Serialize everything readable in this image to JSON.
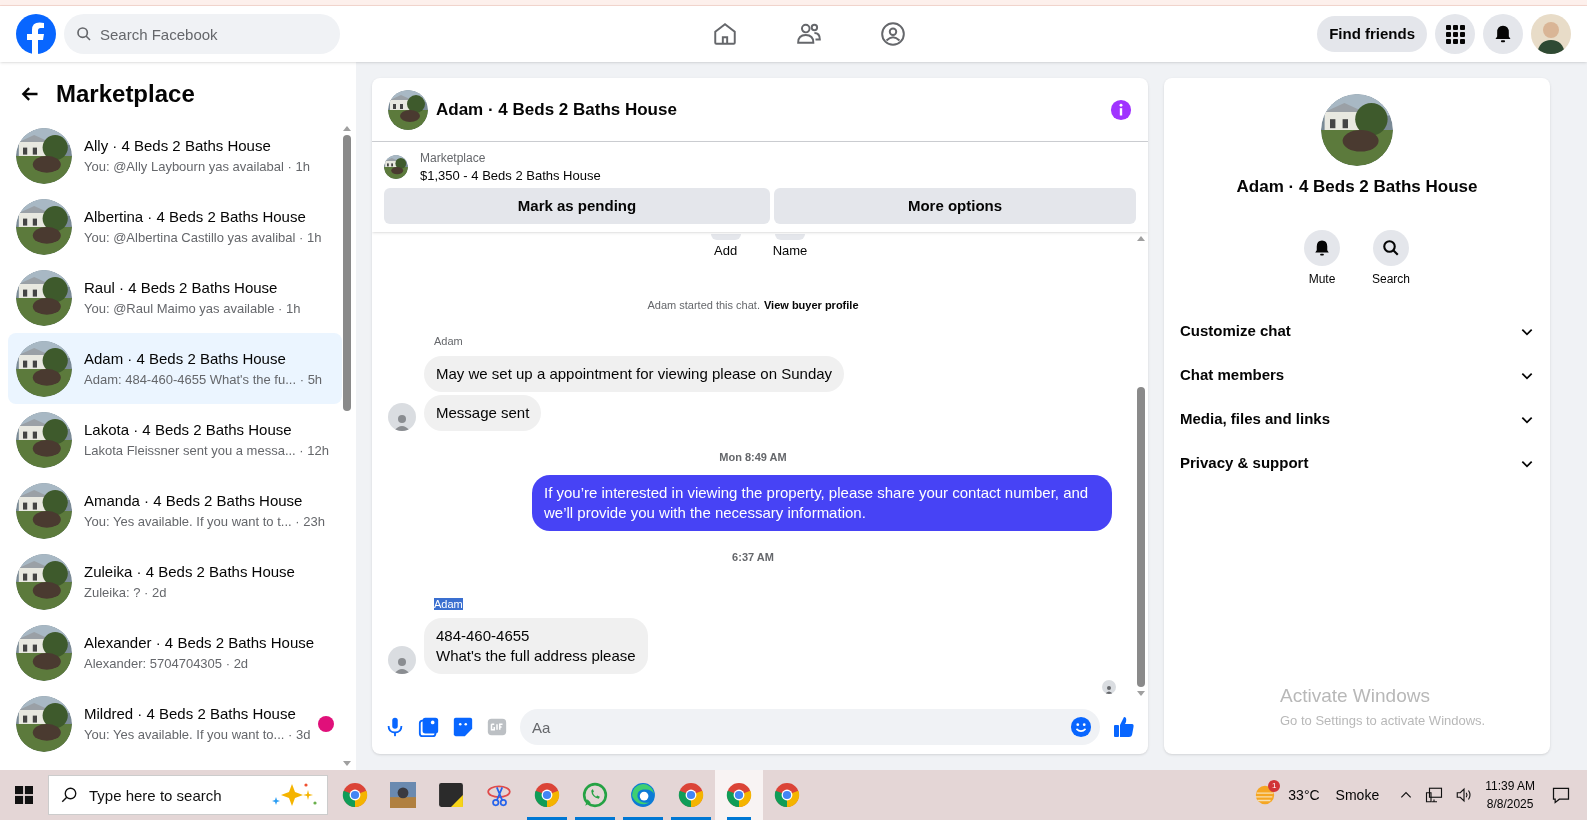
{
  "header": {
    "search": {
      "placeholder": "Search Facebook"
    },
    "find_friends": "Find friends"
  },
  "sidebar": {
    "title": "Marketplace",
    "items": [
      {
        "title": "Ally · 4 Beds 2 Baths House",
        "preview": "You: @Ally Laybourn yas availabal",
        "time": "· 1h",
        "selected": false,
        "unread": false
      },
      {
        "title": "Albertina · 4 Beds 2 Baths House",
        "preview": "You: @Albertina Castillo yas avalibal",
        "time": "· 1h",
        "selected": false,
        "unread": false
      },
      {
        "title": "Raul · 4 Beds 2 Baths House",
        "preview": "You: @Raul Maimo yas available",
        "time": "· 1h",
        "selected": false,
        "unread": false
      },
      {
        "title": "Adam · 4 Beds 2 Baths House",
        "preview": "Adam: 484-460-4655 What's the fu...",
        "time": "· 5h",
        "selected": true,
        "unread": false
      },
      {
        "title": "Lakota · 4 Beds 2 Baths House",
        "preview": "Lakota Fleissner sent you a messa...",
        "time": "· 12h",
        "selected": false,
        "unread": false
      },
      {
        "title": "Amanda · 4 Beds 2 Baths House",
        "preview": "You: Yes available. If you want to t...",
        "time": "· 23h",
        "selected": false,
        "unread": false
      },
      {
        "title": "Zuleika · 4 Beds 2 Baths House",
        "preview": "Zuleika: ?",
        "time": "· 2d",
        "selected": false,
        "unread": false
      },
      {
        "title": "Alexander · 4 Beds 2 Baths House",
        "preview": "Alexander: 5704704305",
        "time": "· 2d",
        "selected": false,
        "unread": false
      },
      {
        "title": "Mildred · 4 Beds 2 Baths House",
        "preview": "You: Yes available. If you want to...",
        "time": "· 3d",
        "selected": false,
        "unread": true
      }
    ]
  },
  "chat": {
    "title": "Adam · 4 Beds 2 Baths House",
    "listing": {
      "label": "Marketplace",
      "price": "$1,350 - 4 Beds 2 Baths House"
    },
    "actions": [
      "Mark as pending",
      "More options"
    ],
    "messages": [
      {
        "kind": "shortcuts",
        "labels": [
          "Add",
          "Name"
        ]
      },
      {
        "kind": "system",
        "text": "Adam started this chat.",
        "link": "View buyer profile"
      },
      {
        "kind": "sender",
        "text": "Adam",
        "highlighted": false
      },
      {
        "kind": "incoming",
        "lines": [
          "May we set up a appointment for viewing please on Sunday"
        ],
        "avatar": false
      },
      {
        "kind": "incoming",
        "lines": [
          "Message sent"
        ],
        "avatar": true
      },
      {
        "kind": "time",
        "text": "Mon 8:49 AM"
      },
      {
        "kind": "outgoing",
        "lines": [
          "If you’re interested in viewing the property, please share your contact number, and we’ll provide you with the necessary information."
        ]
      },
      {
        "kind": "time",
        "text": "6:37 AM"
      },
      {
        "kind": "sender",
        "text": "Adam",
        "highlighted": true
      },
      {
        "kind": "incoming",
        "lines": [
          "484-460-4655",
          "What's the full address please"
        ],
        "avatar": true
      },
      {
        "kind": "seen"
      }
    ],
    "composer": {
      "placeholder": "Aa"
    }
  },
  "info": {
    "title": "Adam · 4 Beds 2 Baths House",
    "buttons": [
      {
        "kind": "bell",
        "label": "Mute"
      },
      {
        "kind": "search",
        "label": "Search"
      }
    ],
    "sections": [
      "Customize chat",
      "Chat members",
      "Media, files and links",
      "Privacy & support"
    ]
  },
  "watermark": {
    "title": "Activate Windows",
    "text": "Go to Settings to activate Windows."
  },
  "taskbar": {
    "search": {
      "placeholder": "Type here to search"
    },
    "apps": [
      {
        "kind": "chrome",
        "open": false,
        "selected": false
      },
      {
        "kind": "game",
        "open": false,
        "selected": false
      },
      {
        "kind": "notes",
        "open": false,
        "selected": false
      },
      {
        "kind": "snip",
        "open": false,
        "selected": false
      },
      {
        "kind": "chrome",
        "open": true,
        "selected": false
      },
      {
        "kind": "whatsapp",
        "open": true,
        "selected": false
      },
      {
        "kind": "edge",
        "open": true,
        "selected": false
      },
      {
        "kind": "chrome",
        "open": true,
        "selected": false
      },
      {
        "kind": "chrome",
        "open": true,
        "selected": true
      },
      {
        "kind": "chrome",
        "open": false,
        "selected": false
      }
    ],
    "weather": {
      "badge": "1",
      "temp": "33°C",
      "condition": "Smoke"
    },
    "time": "11:39 AM",
    "date": "8/8/2025"
  }
}
